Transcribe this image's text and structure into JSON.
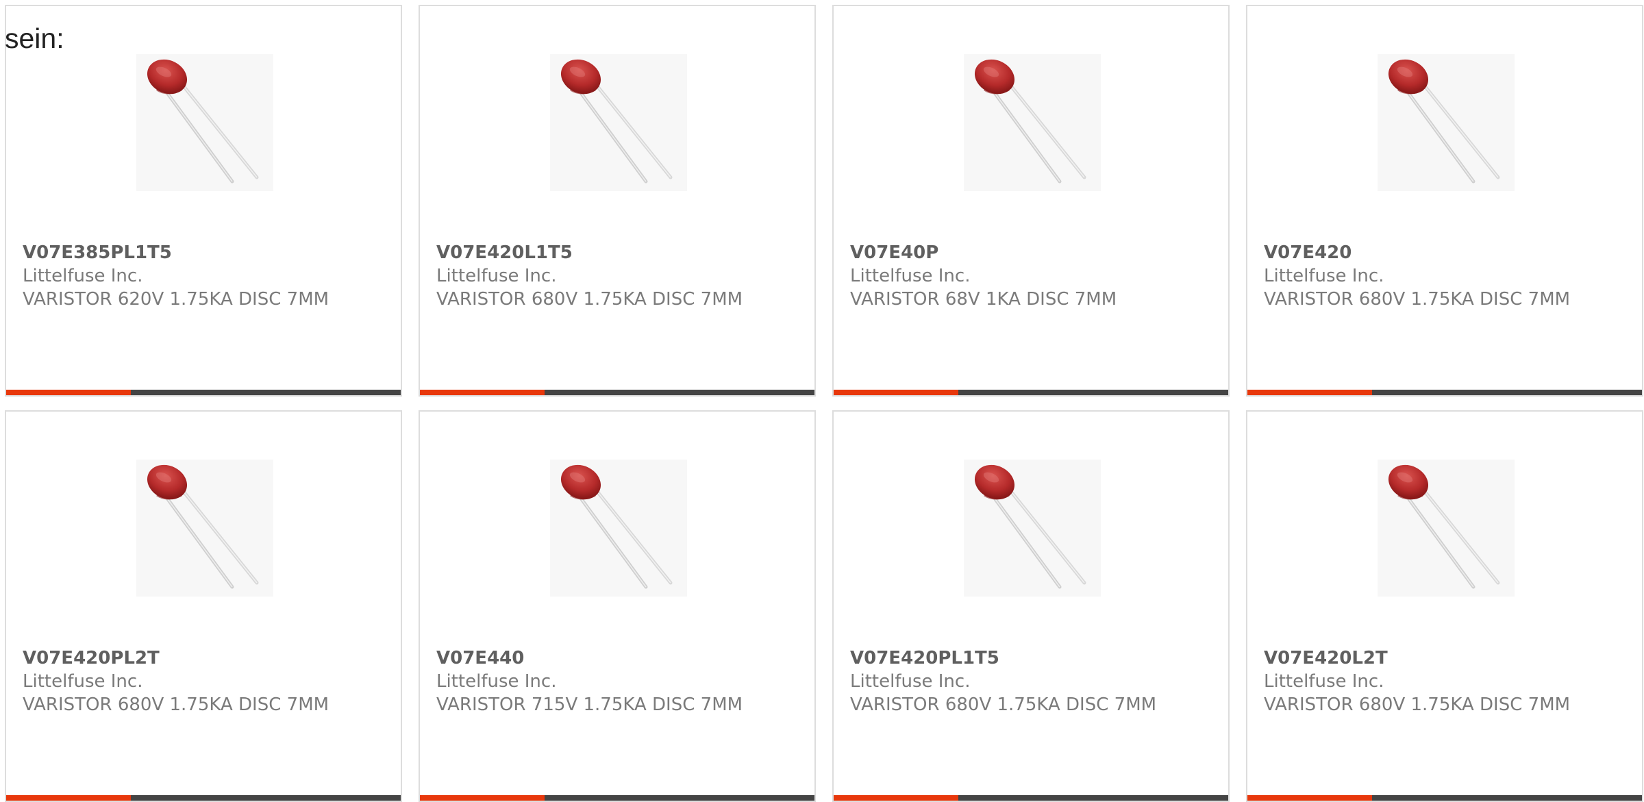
{
  "intro_text": "sein:",
  "colors": {
    "accent": "#e8380c",
    "bar": "#444444",
    "card_border": "#dddddd",
    "text": "#7a7a7a"
  },
  "products": [
    {
      "part_no": "V07E385PL1T5",
      "manufacturer": "Littelfuse Inc.",
      "description": "VARISTOR 620V 1.75KA DISC 7MM",
      "image_icon": "varistor-image"
    },
    {
      "part_no": "V07E420L1T5",
      "manufacturer": "Littelfuse Inc.",
      "description": "VARISTOR 680V 1.75KA DISC 7MM",
      "image_icon": "varistor-image"
    },
    {
      "part_no": "V07E40P",
      "manufacturer": "Littelfuse Inc.",
      "description": "VARISTOR 68V 1KA DISC 7MM",
      "image_icon": "varistor-image"
    },
    {
      "part_no": "V07E420",
      "manufacturer": "Littelfuse Inc.",
      "description": "VARISTOR 680V 1.75KA DISC 7MM",
      "image_icon": "varistor-image"
    },
    {
      "part_no": "V07E420PL2T",
      "manufacturer": "Littelfuse Inc.",
      "description": "VARISTOR 680V 1.75KA DISC 7MM",
      "image_icon": "varistor-image"
    },
    {
      "part_no": "V07E440",
      "manufacturer": "Littelfuse Inc.",
      "description": "VARISTOR 715V 1.75KA DISC 7MM",
      "image_icon": "varistor-image"
    },
    {
      "part_no": "V07E420PL1T5",
      "manufacturer": "Littelfuse Inc.",
      "description": "VARISTOR 680V 1.75KA DISC 7MM",
      "image_icon": "varistor-image"
    },
    {
      "part_no": "V07E420L2T",
      "manufacturer": "Littelfuse Inc.",
      "description": "VARISTOR 680V 1.75KA DISC 7MM",
      "image_icon": "varistor-image"
    }
  ]
}
